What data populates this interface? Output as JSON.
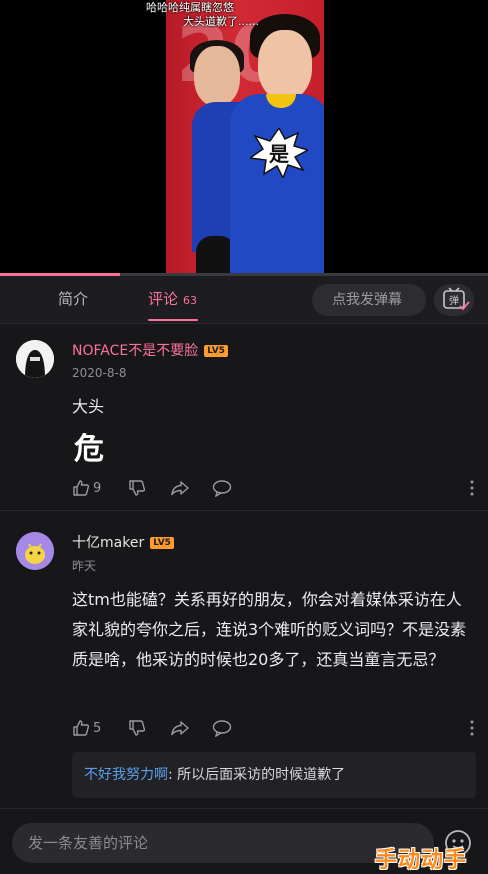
{
  "video": {
    "danmaku_1": "哈哈哈纯属瞎忽悠",
    "danmaku_2": "大头道歉了......",
    "sticker_text": "是",
    "progress": 0.245
  },
  "tabs": {
    "intro_label": "简介",
    "comments_label": "评论",
    "comments_count": "63",
    "danmaku_placeholder": "点我发弹幕",
    "danmaku_toggle_label": "弹"
  },
  "comments": [
    {
      "username": "NOFACE不是不要脸",
      "level": "LV5",
      "date": "2020-8-8",
      "text": "大头",
      "sticker": "危",
      "likes": "9",
      "username_color": "#fb7299"
    },
    {
      "username": "十亿maker",
      "level": "LV5",
      "date": "昨天",
      "text": "这tm也能磕？关系再好的朋友，你会对着媒体采访在人家礼貌的夸你之后，连说3个难听的贬义词吗？不是没素质是啥，他采访的时候也20多了，还真当童言无忌？",
      "likes": "5",
      "username_color": "#e6e6e6",
      "reply": {
        "user": "不好我努力啊",
        "text": ": 所以后面采访的时候道歉了"
      }
    }
  ],
  "bottom": {
    "input_placeholder": "发一条友善的评论"
  },
  "watermark": "手动动手游",
  "colors": {
    "accent": "#fb7299",
    "background": "#17171a",
    "level_badge": "#ff9b2f",
    "reply_link": "#5a9ee8"
  }
}
